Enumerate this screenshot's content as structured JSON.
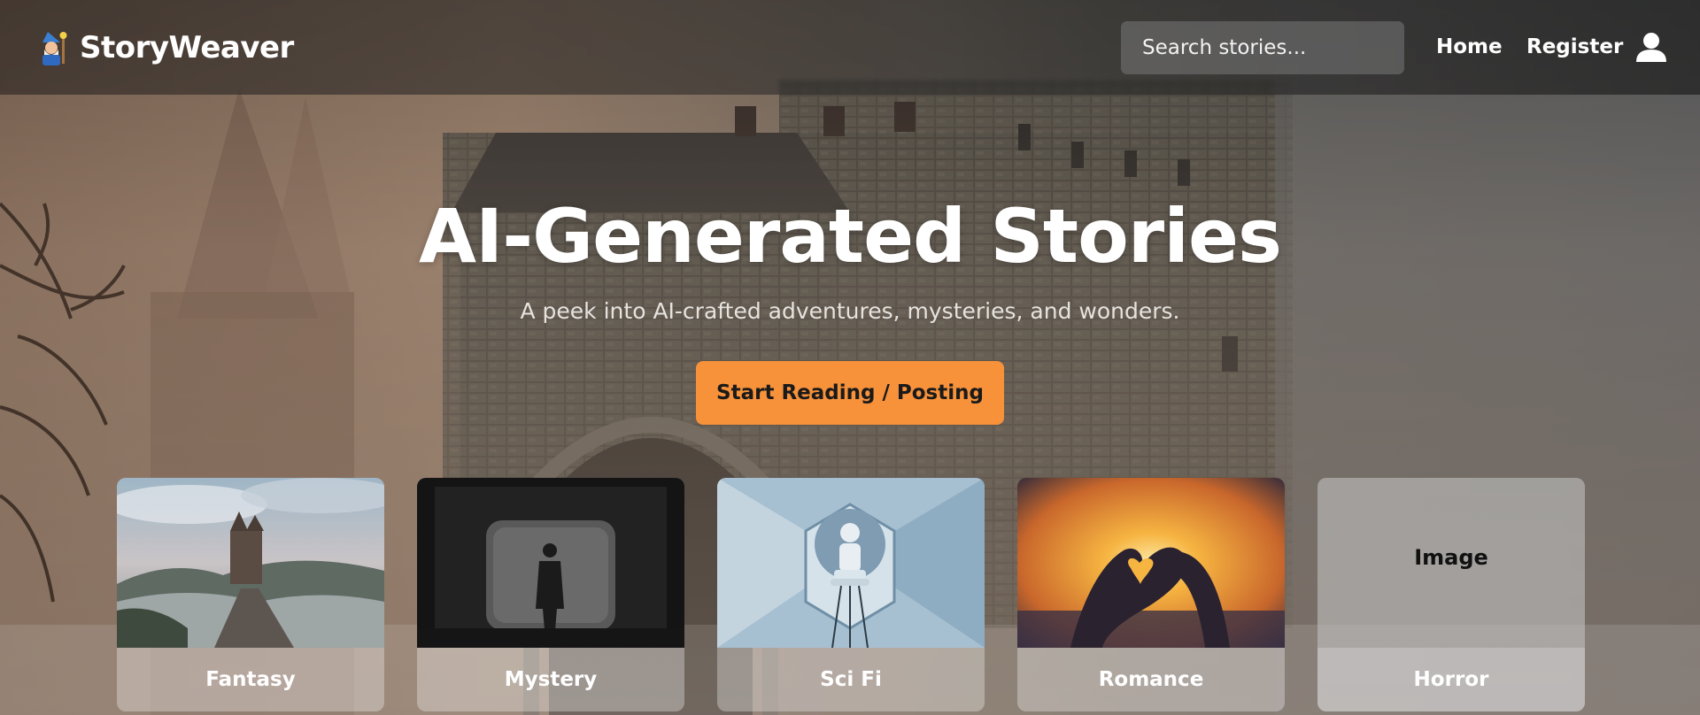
{
  "header": {
    "brand": "StoryWeaver",
    "search_placeholder": "Search stories...",
    "nav": {
      "home": "Home",
      "register": "Register"
    }
  },
  "hero": {
    "title": "AI-Generated Stories",
    "subtitle": "A peek into AI-crafted adventures, mysteries, and wonders.",
    "cta": "Start Reading / Posting"
  },
  "categories": [
    {
      "label": "Fantasy"
    },
    {
      "label": "Mystery"
    },
    {
      "label": "Sci Fi"
    },
    {
      "label": "Romance"
    },
    {
      "label": "Horror",
      "placeholder": "Image"
    }
  ],
  "colors": {
    "accent": "#f7913a",
    "text": "#ffffff"
  }
}
